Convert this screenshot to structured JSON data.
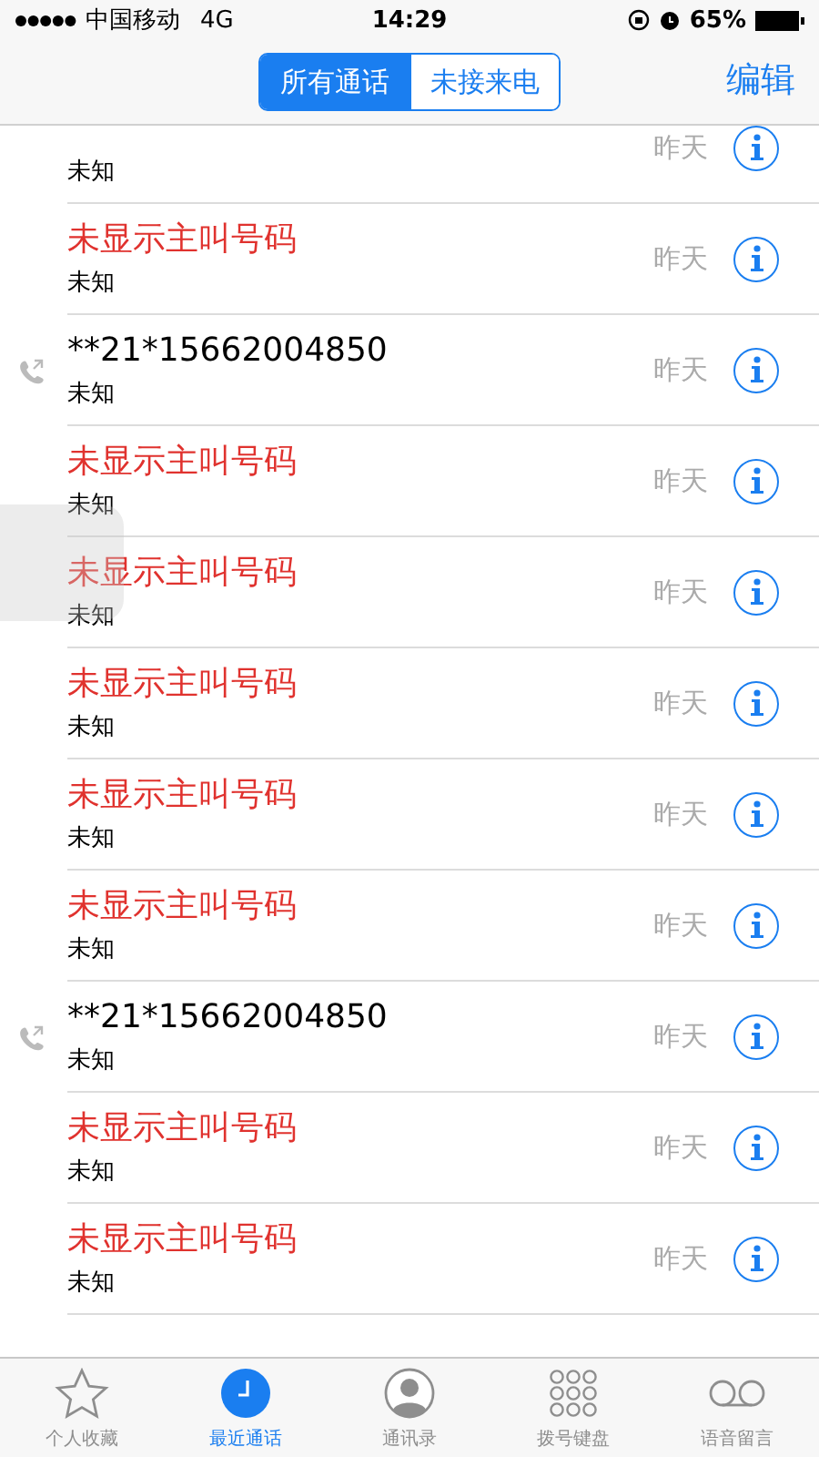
{
  "status_bar": {
    "carrier": "中国移动",
    "network": "4G",
    "time": "14:29",
    "battery": "65%"
  },
  "segments": [
    {
      "label": "所有通话",
      "selected": true
    },
    {
      "label": "未接来电",
      "selected": false
    }
  ],
  "edit": "编辑",
  "calls": [
    {
      "detail": "未知",
      "when": "昨天"
    },
    {
      "kind": "missed",
      "name": "未显示主叫号码",
      "detail": "未知",
      "when": "昨天"
    },
    {
      "kind": "outgoing",
      "name": "**21*15662004850",
      "detail": "未知",
      "when": "昨天"
    },
    {
      "kind": "missed",
      "name": "未显示主叫号码",
      "detail": "未知",
      "when": "昨天"
    },
    {
      "kind": "missed",
      "name": "未显示主叫号码",
      "detail": "未知",
      "when": "昨天"
    },
    {
      "kind": "missed",
      "name": "未显示主叫号码",
      "detail": "未知",
      "when": "昨天"
    },
    {
      "kind": "missed",
      "name": "未显示主叫号码",
      "detail": "未知",
      "when": "昨天"
    },
    {
      "kind": "missed",
      "name": "未显示主叫号码",
      "detail": "未知",
      "when": "昨天"
    },
    {
      "kind": "outgoing",
      "name": "**21*15662004850",
      "detail": "未知",
      "when": "昨天"
    },
    {
      "kind": "missed",
      "name": "未显示主叫号码",
      "detail": "未知",
      "when": "昨天"
    },
    {
      "kind": "missed",
      "name": "未显示主叫号码",
      "detail": "未知",
      "when": "昨天"
    }
  ],
  "tabs": [
    {
      "kind": "favorites",
      "label": "个人收藏",
      "selected": false
    },
    {
      "kind": "recents",
      "label": "最近通话",
      "selected": true
    },
    {
      "kind": "contacts",
      "label": "通讯录",
      "selected": false
    },
    {
      "kind": "keypad",
      "label": "拨号键盘",
      "selected": false
    },
    {
      "kind": "voicemail",
      "label": "语音留言",
      "selected": false
    }
  ]
}
